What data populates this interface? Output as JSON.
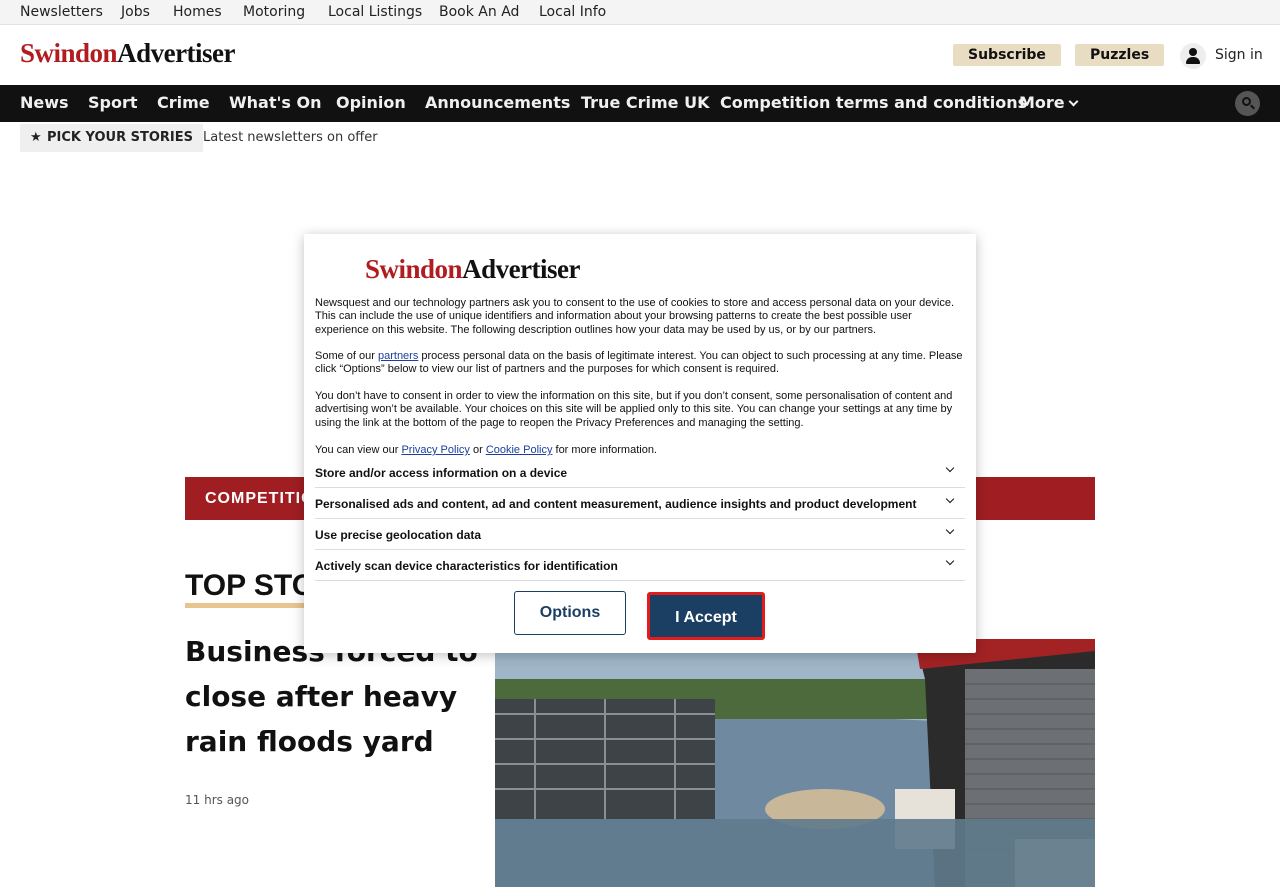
{
  "util_nav": [
    "Newsletters",
    "Jobs",
    "Homes",
    "Motoring",
    "Local Listings",
    "Book An Ad",
    "Local Info"
  ],
  "brand": {
    "part1": "Swindon",
    "part2": "Advertiser",
    "color_red": "#b01c1f"
  },
  "header": {
    "subscribe": "Subscribe",
    "puzzles": "Puzzles",
    "sign_in": "Sign in",
    "user_icon": "user-icon"
  },
  "main_nav": [
    "News",
    "Sport",
    "Crime",
    "What's On",
    "Opinion",
    "Announcements",
    "True Crime UK",
    "Competition terms and conditions",
    "More"
  ],
  "search_icon": "search-icon",
  "pick": {
    "label": "PICK YOUR STORIES",
    "link": "Latest newsletters on offer",
    "icon": "star-icon"
  },
  "content": {
    "competition_bar": "COMPETITIO",
    "section_title": "TOP STO",
    "headline": "Business forced to close after heavy rain floods yard",
    "time_ago": "11 hrs ago"
  },
  "consent": {
    "p1": "Newsquest and our technology partners ask you to consent to the use of cookies to store and access personal data on your device. This can include the use of unique identifiers and information about your browsing patterns to create the best possible user experience on this website. The following description outlines how your data may be used by us, or by our partners.",
    "p2_pre": "Some of our ",
    "p2_link": "partners",
    "p2_post": " process personal data on the basis of legitimate interest. You can object to such processing at any time. Please click “Options” below to view our list of partners and the purposes for which consent is required.",
    "p3": "You don’t have to consent in order to view the information on this site, but if you don’t consent, some personalisation of content and advertising won’t be available. Your choices on this site will be applied only to this site. You can change your settings at any time by using the link at the bottom of the page to reopen the Privacy Preferences and managing the setting.",
    "p4_pre": "You can view our ",
    "p4_link1": "Privacy Policy",
    "p4_mid": " or ",
    "p4_link2": "Cookie Policy",
    "p4_post": " for more information.",
    "purposes": [
      "Store and/or access information on a device",
      "Personalised ads and content, ad and content measurement, audience insights and product development",
      "Use precise geolocation data",
      "Actively scan device characteristics for identification"
    ],
    "options_label": "Options",
    "accept_label": "I Accept"
  }
}
